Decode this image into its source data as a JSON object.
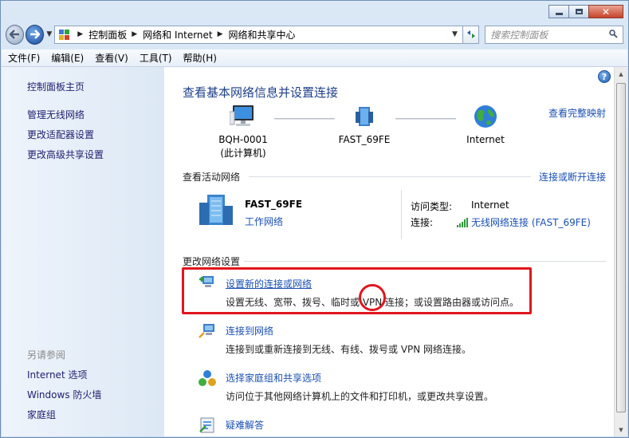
{
  "window": {
    "caption": {
      "minimize": "",
      "maximize": "",
      "close": "✕"
    }
  },
  "nav": {
    "breadcrumbs": [
      "控制面板",
      "网络和 Internet",
      "网络和共享中心"
    ],
    "search_placeholder": "搜索控制面板"
  },
  "menu": [
    "文件(F)",
    "编辑(E)",
    "查看(V)",
    "工具(T)",
    "帮助(H)"
  ],
  "sidebar": {
    "links": [
      "控制面板主页",
      "管理无线网络",
      "更改适配器设置",
      "更改高级共享设置"
    ],
    "see_also_heading": "另请参阅",
    "see_also": [
      "Internet 选项",
      "Windows 防火墙",
      "家庭组"
    ]
  },
  "main": {
    "title": "查看基本网络信息并设置连接",
    "full_map_link": "查看完整映射",
    "map": {
      "computer_name": "BQH-0001",
      "computer_sub": "(此计算机)",
      "router_name": "FAST_69FE",
      "internet_name": "Internet"
    },
    "active_section_label": "查看活动网络",
    "connect_disconnect_link": "连接或断开连接",
    "active_network": {
      "name": "FAST_69FE",
      "category": "工作网络",
      "access_type_label": "访问类型:",
      "access_type_value": "Internet",
      "connection_label": "连接:",
      "connection_value": "无线网络连接 (FAST_69FE)"
    },
    "change_section_label": "更改网络设置",
    "tasks": [
      {
        "title": "设置新的连接或网络",
        "description": "设置无线、宽带、拨号、临时或 VPN 连接；或设置路由器或访问点。"
      },
      {
        "title": "连接到网络",
        "description": "连接到或重新连接到无线、有线、拨号或 VPN 网络连接。"
      },
      {
        "title": "选择家庭组和共享选项",
        "description": "访问位于其他网络计算机上的文件和打印机，或更改共享设置。"
      },
      {
        "title": "疑难解答",
        "description": ""
      }
    ]
  },
  "annotations": {
    "highlight_color": "#e0161e"
  }
}
